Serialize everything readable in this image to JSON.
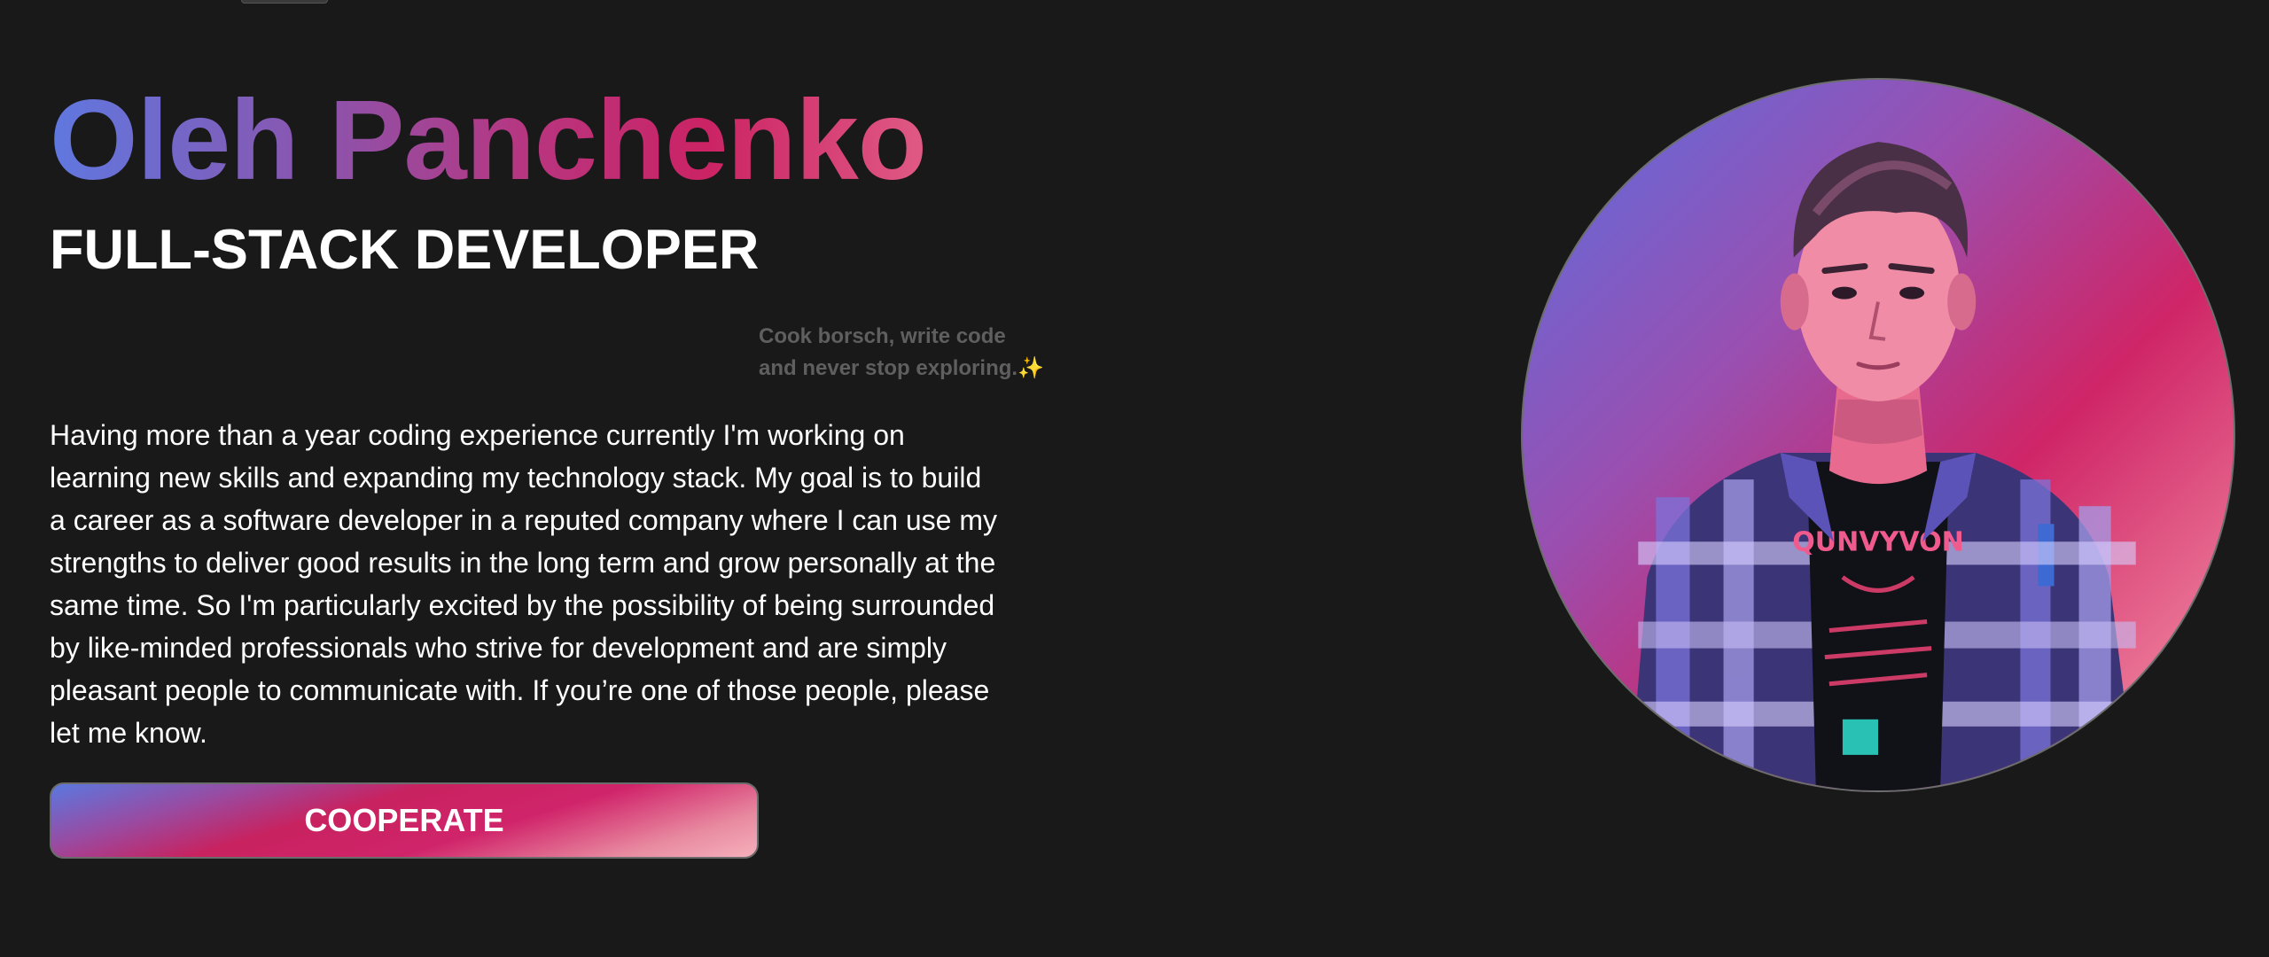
{
  "hero": {
    "name": "Oleh Panchenko",
    "role": "FULL-STACK DEVELOPER",
    "motto_lines": [
      "Cook borsch, write code",
      "and never stop exploring."
    ],
    "motto_emoji": "✨",
    "bio_lines": [
      "Having more than a year coding experience currently I'm working on",
      "learning new skills and expanding my technology stack. My goal is to build",
      "a career as a software developer in a reputed company where I can use my",
      "strengths to deliver good results in the long term and grow personally at the",
      "same time. So I'm particularly excited by the possibility of being surrounded",
      "by like-minded professionals who strive for development and are simply",
      "pleasant people to communicate with. If you’re one of those people, please",
      "let me know."
    ],
    "cta_label": "COOPERATE",
    "portrait_shirt_text": "QUNVYVON"
  },
  "colors": {
    "background": "#191919",
    "gradient_start": "#5f78e0",
    "gradient_mid": "#cb2364",
    "gradient_end": "#e05a85",
    "motto": "#5f5f5f"
  }
}
